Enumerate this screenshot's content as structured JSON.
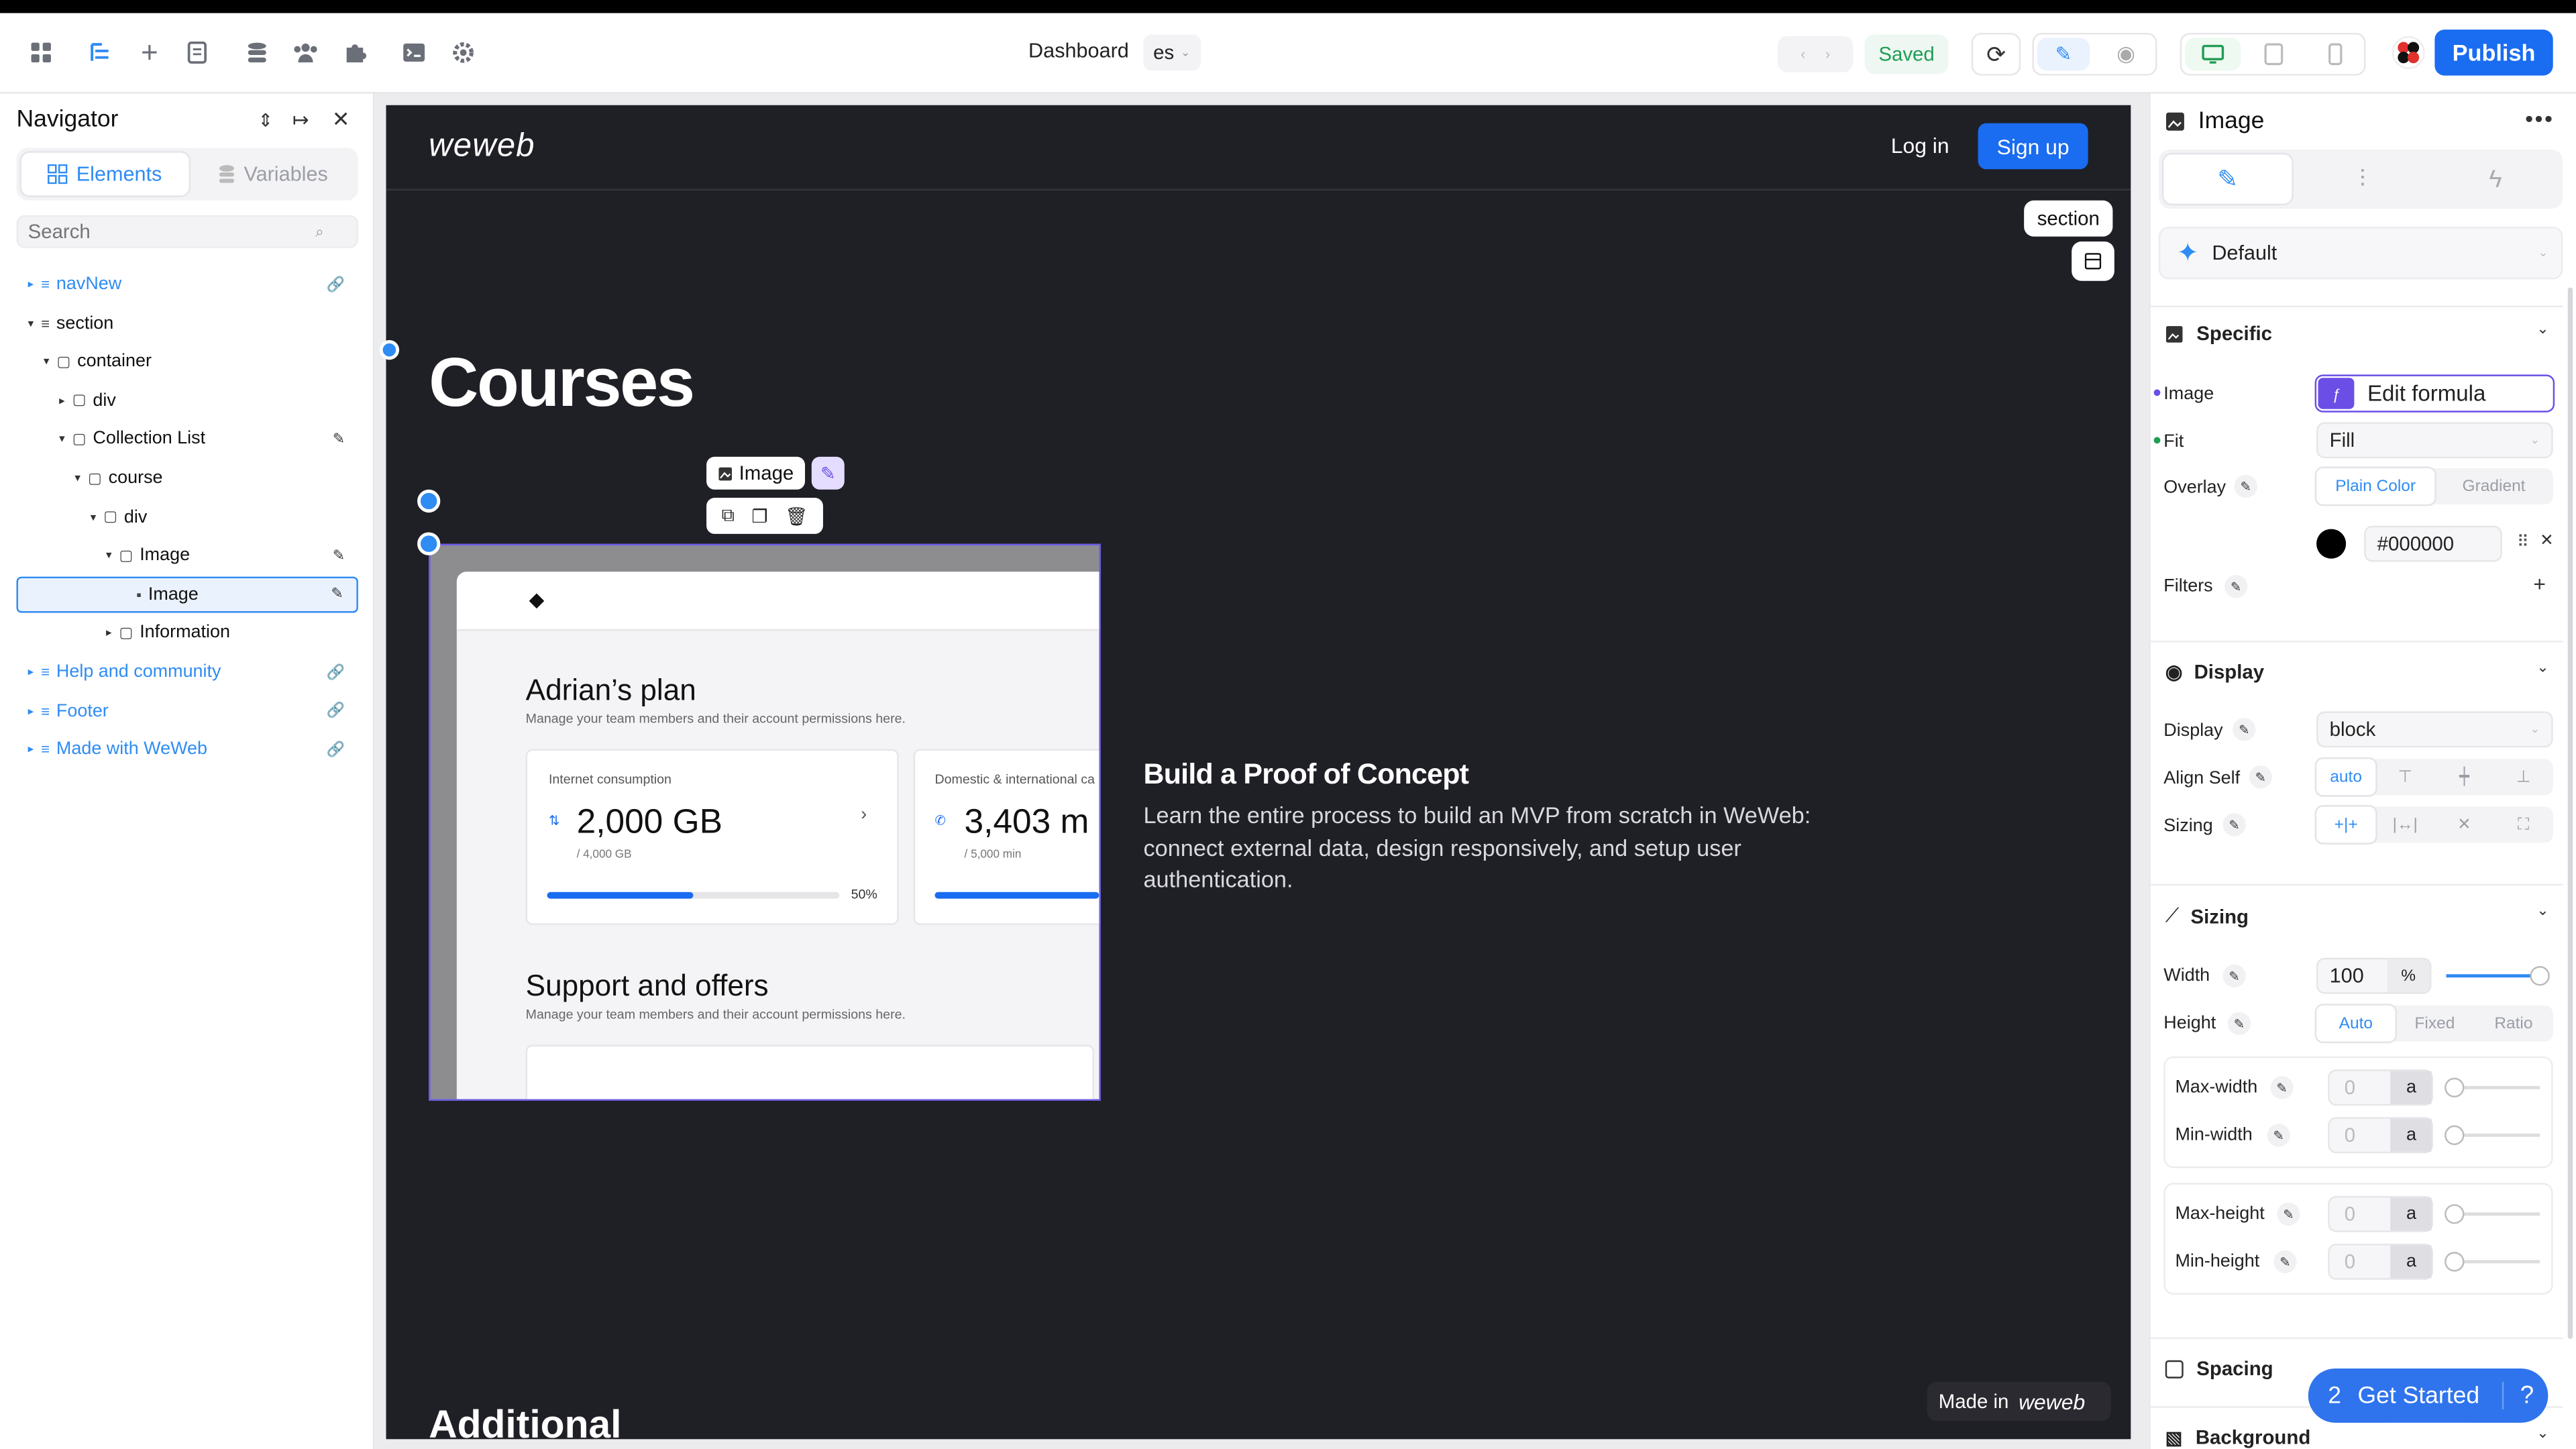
{
  "header": {
    "page_name": "Dashboard",
    "language": "es",
    "saved": "Saved",
    "publish": "Publish"
  },
  "navigator": {
    "title": "Navigator",
    "tabs": [
      "Elements",
      "Variables"
    ],
    "search_placeholder": "Search",
    "tree": [
      {
        "label": "navNew",
        "indent": 0,
        "type": "component"
      },
      {
        "label": "section",
        "indent": 0,
        "type": "section"
      },
      {
        "label": "container",
        "indent": 1,
        "type": "box"
      },
      {
        "label": "div",
        "indent": 2,
        "type": "box"
      },
      {
        "label": "Collection List",
        "indent": 2,
        "type": "box"
      },
      {
        "label": "course",
        "indent": 3,
        "type": "box"
      },
      {
        "label": "div",
        "indent": 4,
        "type": "box"
      },
      {
        "label": "Image",
        "indent": 5,
        "type": "box"
      },
      {
        "label": "Image",
        "indent": 6,
        "type": "image",
        "selected": true
      },
      {
        "label": "Information",
        "indent": 5,
        "type": "box"
      },
      {
        "label": "Help and community",
        "indent": 0,
        "type": "component"
      },
      {
        "label": "Footer",
        "indent": 0,
        "type": "component"
      },
      {
        "label": "Made with WeWeb",
        "indent": 0,
        "type": "component"
      }
    ]
  },
  "canvas": {
    "logo": "weweb",
    "login": "Log in",
    "signup": "Sign up",
    "section_tooltip": "section",
    "heading": "Courses",
    "image_badge": "Image",
    "course_title": "Build a Proof of Concept",
    "course_desc": "Learn the entire process to build an MVP from scratch in WeWeb: connect external data, design responsively, and setup user authentication.",
    "additional": "Additional",
    "made_in": "Made in",
    "made_in_logo": "weweb",
    "mockup": {
      "plan_title": "Adrian’s plan",
      "plan_sub": "Manage your team members and their account permissions here.",
      "card1_label": "Internet consumption",
      "card1_value": "2,000 GB",
      "card1_sub": "/ 4,000 GB",
      "card1_pct": "50%",
      "card1_progress": 0.5,
      "card2_label": "Domestic & international ca",
      "card2_value": "3,403 m",
      "card2_sub": "/ 5,000 min",
      "support_title": "Support and offers",
      "support_sub": "Manage your team members and their account permissions here."
    }
  },
  "panel": {
    "title": "Image",
    "preset": "Default",
    "specific": {
      "title": "Specific",
      "image_label": "Image",
      "image_value": "Edit formula",
      "fit_label": "Fit",
      "fit_value": "Fill",
      "overlay_label": "Overlay",
      "overlay_tabs": [
        "Plain Color",
        "Gradient"
      ],
      "color_value": "#000000",
      "filters_label": "Filters"
    },
    "display": {
      "title": "Display",
      "display_label": "Display",
      "display_value": "block",
      "align_label": "Align Self",
      "align_value": "auto",
      "sizing_label": "Sizing"
    },
    "sizing": {
      "title": "Sizing",
      "width_label": "Width",
      "width_value": "100",
      "width_unit": "%",
      "height_label": "Height",
      "height_tabs": [
        "Auto",
        "Fixed",
        "Ratio"
      ],
      "max_width_label": "Max-width",
      "min_width_label": "Min-width",
      "max_height_label": "Max-height",
      "min_height_label": "Min-height",
      "zero": "0",
      "unit_a": "a"
    },
    "spacing_title": "Spacing",
    "background_title": "Background",
    "get_started": "Get Started",
    "get_started_count": "2"
  },
  "colors": {
    "accent": "#1a6cf0",
    "canvas_bg": "#1f1f26",
    "saved_green": "#1f9d55",
    "formula_purple": "#6b4ee6"
  }
}
